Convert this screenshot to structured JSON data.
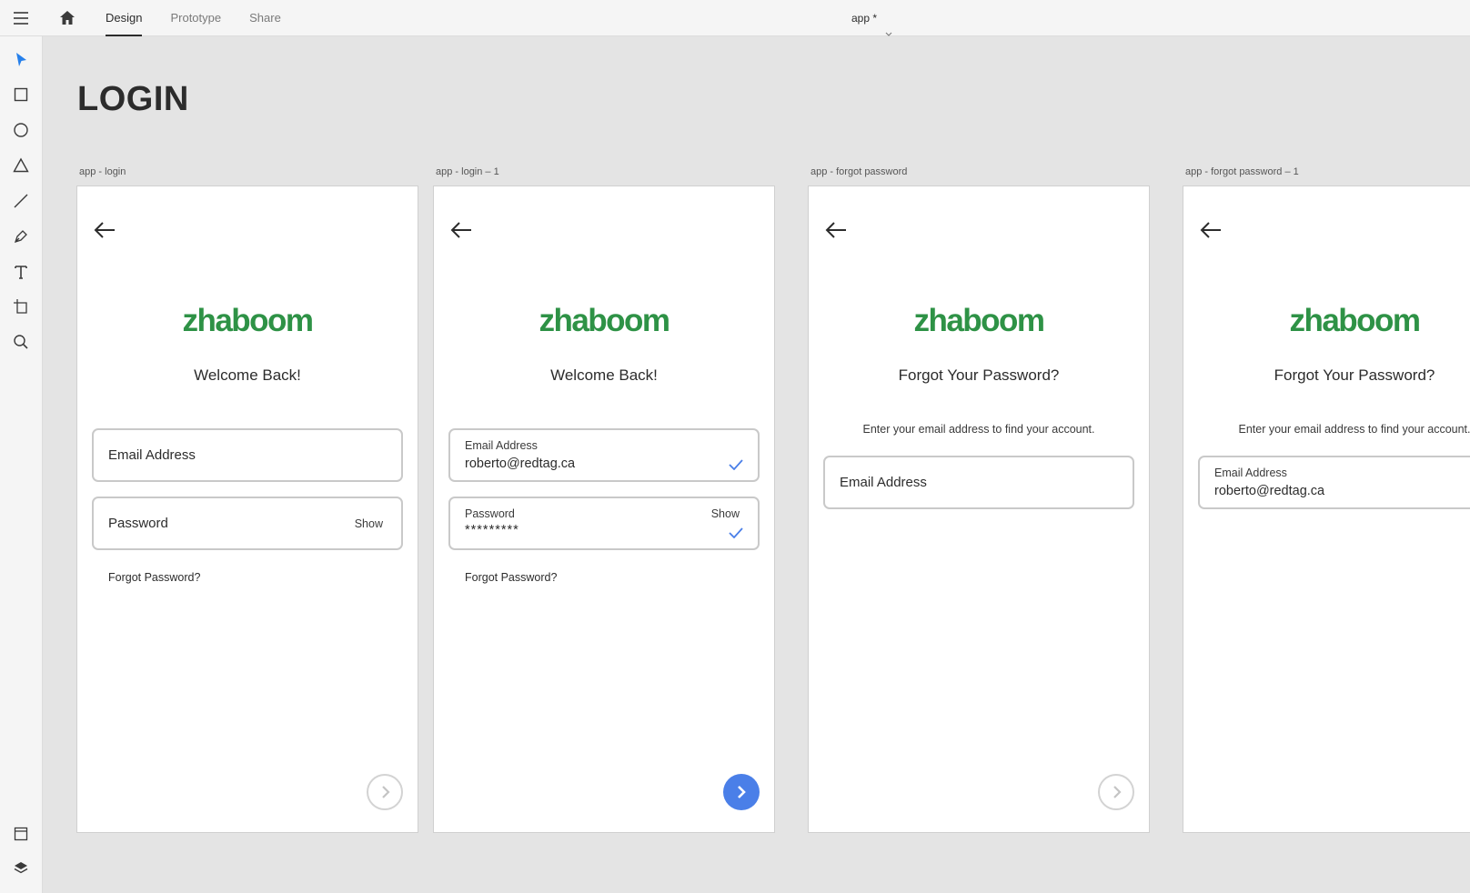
{
  "app": {
    "menu_icon": "hamburger-menu-icon",
    "home_icon": "home-icon",
    "tabs": [
      {
        "label": "Design",
        "active": true
      },
      {
        "label": "Prototype",
        "active": false
      },
      {
        "label": "Share",
        "active": false
      }
    ],
    "document_name": "app *"
  },
  "toolbar": {
    "tools": [
      "select-tool-icon",
      "rectangle-tool-icon",
      "ellipse-tool-icon",
      "polygon-tool-icon",
      "line-tool-icon",
      "pen-tool-icon",
      "text-tool-icon",
      "artboard-tool-icon",
      "zoom-tool-icon"
    ],
    "bottom": [
      "assets-icon",
      "layers-icon"
    ]
  },
  "canvas": {
    "title": "LOGIN",
    "artboards": [
      {
        "label": "app - login",
        "logo": "zhaboom",
        "heading": "Welcome Back!",
        "email_placeholder": "Email Address",
        "password_placeholder": "Password",
        "show_label": "Show",
        "forgot_label": "Forgot Password?",
        "next_enabled": false
      },
      {
        "label": "app - login – 1",
        "logo": "zhaboom",
        "heading": "Welcome Back!",
        "email_label": "Email Address",
        "email_value": "roberto@redtag.ca",
        "password_label": "Password",
        "password_value": "*********",
        "show_label": "Show",
        "forgot_label": "Forgot Password?",
        "next_enabled": true
      },
      {
        "label": "app - forgot password",
        "logo": "zhaboom",
        "heading": "Forgot Your Password?",
        "subtext": "Enter your email address to find your account.",
        "email_placeholder": "Email Address",
        "next_enabled": false
      },
      {
        "label": "app - forgot password – 1",
        "logo": "zhaboom",
        "heading": "Forgot Your Password?",
        "subtext": "Enter your email address to find your account.",
        "email_label": "Email Address",
        "email_value": "roberto@redtag.ca"
      }
    ]
  },
  "colors": {
    "brand_green": "#2e9246",
    "accent_blue": "#4a7fe8",
    "canvas_bg": "#e4e4e4"
  }
}
